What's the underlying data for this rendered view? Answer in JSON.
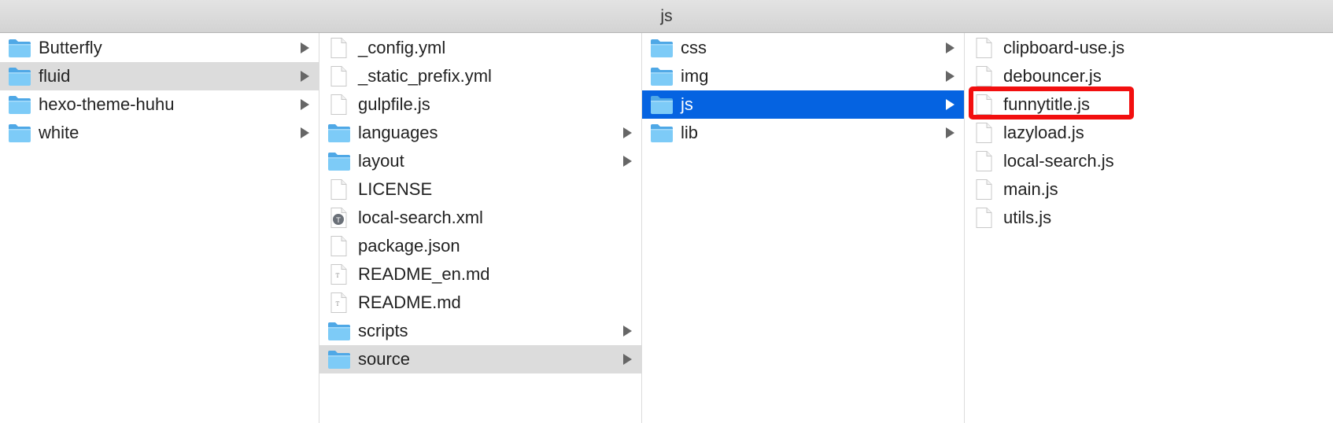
{
  "window": {
    "title": "js"
  },
  "columns": [
    {
      "items": [
        {
          "label": "Butterfly",
          "type": "folder",
          "expandable": true
        },
        {
          "label": "fluid",
          "type": "folder",
          "expandable": true,
          "state": "path"
        },
        {
          "label": "hexo-theme-huhu",
          "type": "folder",
          "expandable": true
        },
        {
          "label": "white",
          "type": "folder",
          "expandable": true
        }
      ]
    },
    {
      "items": [
        {
          "label": "_config.yml",
          "type": "file"
        },
        {
          "label": "_static_prefix.yml",
          "type": "file"
        },
        {
          "label": "gulpfile.js",
          "type": "file"
        },
        {
          "label": "languages",
          "type": "folder",
          "expandable": true
        },
        {
          "label": "layout",
          "type": "folder",
          "expandable": true
        },
        {
          "label": "LICENSE",
          "type": "file"
        },
        {
          "label": "local-search.xml",
          "type": "xml"
        },
        {
          "label": "package.json",
          "type": "file"
        },
        {
          "label": "README_en.md",
          "type": "text"
        },
        {
          "label": "README.md",
          "type": "text"
        },
        {
          "label": "scripts",
          "type": "folder",
          "expandable": true
        },
        {
          "label": "source",
          "type": "folder",
          "expandable": true,
          "state": "path"
        }
      ]
    },
    {
      "items": [
        {
          "label": "css",
          "type": "folder",
          "expandable": true
        },
        {
          "label": "img",
          "type": "folder",
          "expandable": true
        },
        {
          "label": "js",
          "type": "folder",
          "expandable": true,
          "state": "selected"
        },
        {
          "label": "lib",
          "type": "folder",
          "expandable": true
        }
      ]
    },
    {
      "items": [
        {
          "label": "clipboard-use.js",
          "type": "file"
        },
        {
          "label": "debouncer.js",
          "type": "file"
        },
        {
          "label": "funnytitle.js",
          "type": "file",
          "highlighted": true
        },
        {
          "label": "lazyload.js",
          "type": "file"
        },
        {
          "label": "local-search.js",
          "type": "file"
        },
        {
          "label": "main.js",
          "type": "file"
        },
        {
          "label": "utils.js",
          "type": "file"
        }
      ]
    }
  ],
  "colors": {
    "selection": "#0563e1",
    "path_selection": "#dcdcdc",
    "annotation": "#f20f0f",
    "folder": "#6dc3f5"
  }
}
